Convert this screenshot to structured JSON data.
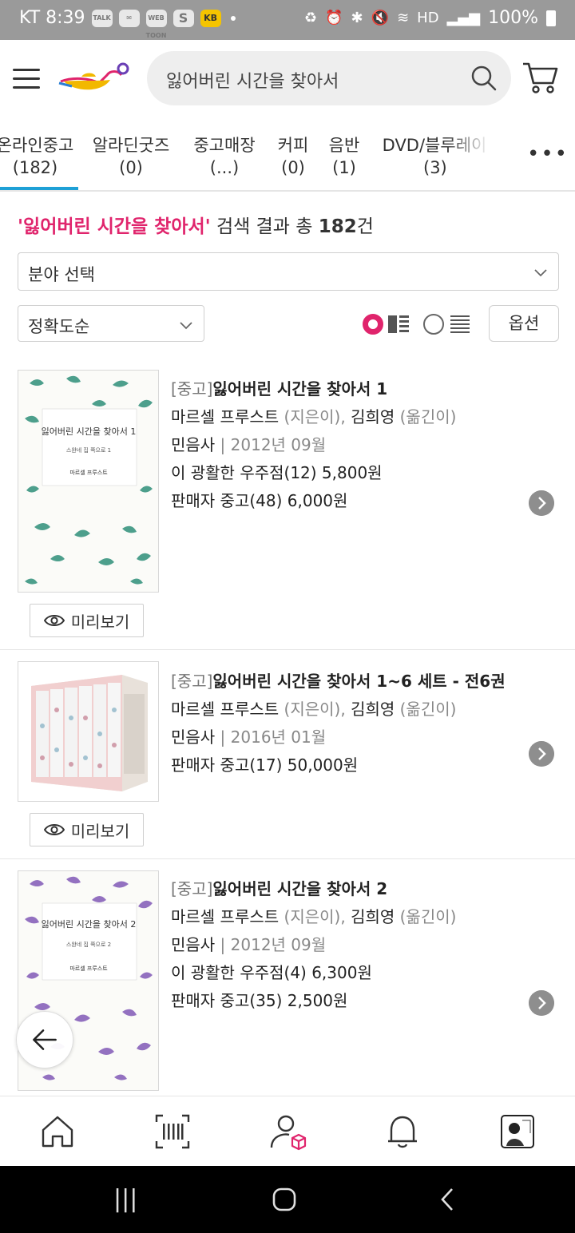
{
  "status_bar": {
    "carrier_time": "KT 8:39",
    "notif_icons": [
      "talk-icon",
      "mail-icon",
      "webtoon-icon",
      "s-icon",
      "kb-icon"
    ],
    "webtoon_label": "WEB TOON",
    "talk_label": "TALK",
    "s_label": "S",
    "kb_label": "KB",
    "battery": "100%"
  },
  "header": {
    "search_value": "잃어버린 시간을 찾아서"
  },
  "tabs": [
    {
      "label": "온라인중고",
      "count": "(182)",
      "active": true
    },
    {
      "label": "알라딘굿즈",
      "count": "(0)"
    },
    {
      "label": "중고매장",
      "count": "(...)"
    },
    {
      "label": "커피",
      "count": "(0)"
    },
    {
      "label": "음반",
      "count": "(1)"
    },
    {
      "label": "DVD/블루레이",
      "count": "(3)"
    }
  ],
  "results": {
    "query": "'잃어버린 시간을 찾아서'",
    "mid": " 검색 결과 총 ",
    "count": "182",
    "suffix": "건"
  },
  "filters": {
    "category": "분야 선택",
    "sort": "정확도순",
    "options_label": "옵션"
  },
  "items": [
    {
      "tag": "[중고]",
      "title": "잃어버린 시간을 찾아서 1",
      "author": "마르셀 프루스트",
      "author_role": " (지은이), ",
      "translator": "김희영",
      "translator_role": " (옮긴이)",
      "publisher": "민음사",
      "date": " | 2012년 09월",
      "line4": "이 광활한 우주점(12) 5,800원",
      "line5": "판매자 중고(48) 6,000원",
      "preview": "미리보기",
      "cover": {
        "title": "잃어버린 시간을 찾아서 1",
        "sub": "스완네 집 쪽으로 1",
        "author": "마르셀 프루스트",
        "leaf_color": "#2f8f7a"
      }
    },
    {
      "tag": "[중고]",
      "title": "잃어버린 시간을 찾아서 1~6 세트 - 전6권",
      "author": "마르셀 프루스트",
      "author_role": " (지은이), ",
      "translator": "김희영",
      "translator_role": " (옮긴이)",
      "publisher": "민음사",
      "date": " | 2016년 01월",
      "line4": "판매자 중고(17) 50,000원",
      "preview": "미리보기"
    },
    {
      "tag": "[중고]",
      "title": "잃어버린 시간을 찾아서 2",
      "author": "마르셀 프루스트",
      "author_role": " (지은이), ",
      "translator": "김희영",
      "translator_role": " (옮긴이)",
      "publisher": "민음사",
      "date": " | 2012년 09월",
      "line4": "이 광활한 우주점(4) 6,300원",
      "line5": "판매자 중고(35) 2,500원",
      "cover": {
        "title": "잃어버린 시간을 찾아서 2",
        "sub": "스완네 집 쪽으로 2",
        "author": "마르셀 프루스트",
        "leaf_color": "#7a4fb3"
      }
    }
  ],
  "colors": {
    "accent_pink": "#e0246c",
    "tab_underline": "#1ea0d6",
    "cart_badge": "#e0246c"
  },
  "bottom_nav": [
    "home-icon",
    "barcode-icon",
    "my-account-icon",
    "bell-icon",
    "profile-thumb"
  ]
}
